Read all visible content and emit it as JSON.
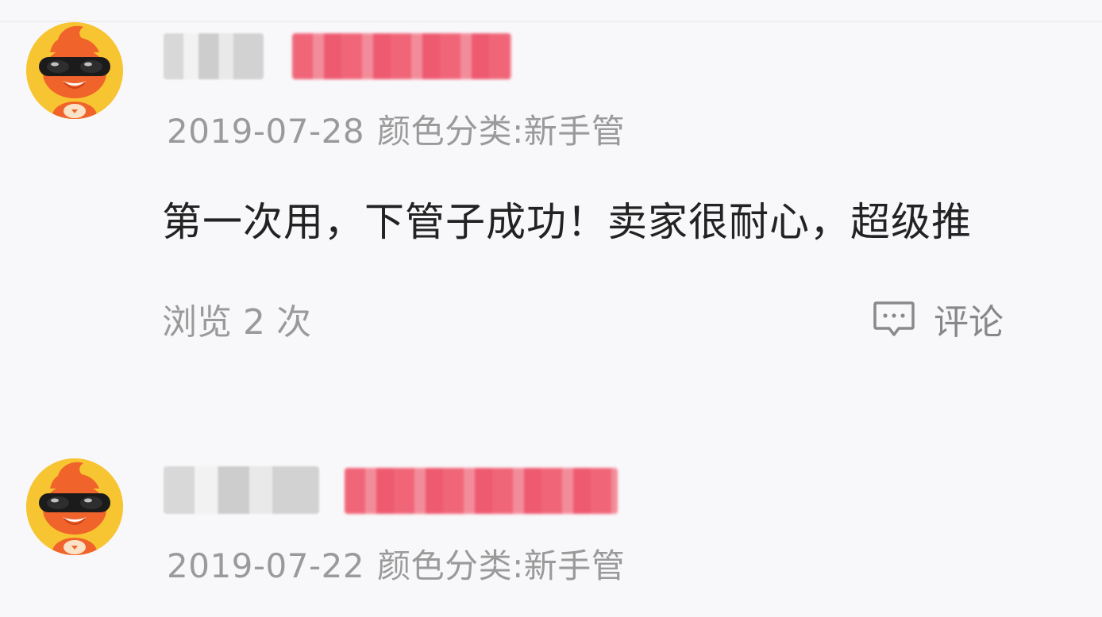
{
  "reviews": [
    {
      "date": "2019-07-28",
      "sku": "颜色分类:新手管",
      "content": "第一次用，下管子成功！卖家很耐心，超级推",
      "views": "浏览 2 次",
      "comment_label": "评论"
    },
    {
      "date": "2019-07-22",
      "sku": "颜色分类:新手管"
    }
  ],
  "icons": {
    "avatar": "cartoon-mascot-sunglasses-icon",
    "comment": "chat-bubble-icon"
  },
  "colors": {
    "background": "#f8f7f9",
    "avatar_bg": "#f7c531",
    "mascot": "#f0632a",
    "badge_blur": "#f05a6e",
    "meta_text": "#9a9a9a",
    "content_text": "#222222"
  }
}
